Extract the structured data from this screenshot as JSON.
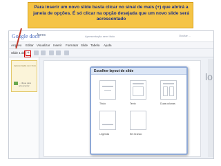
{
  "callout": {
    "text": "Para inserir um novo slide basta clicar no sinal de mais (+) que abrirá a janela de opções. É só clicar na opção desejada que um novo slide será acrescentado"
  },
  "app": {
    "logo": "Google docs",
    "tab": "Apres",
    "doc_title": "Apresentação sem título",
    "top_right": "Ocultar ..."
  },
  "menus": [
    "Arquivo",
    "Editar",
    "Visualizar",
    "Inserir",
    "Formatar",
    "Slide",
    "Tabela",
    "Ajuda"
  ],
  "toolbar": {
    "slide_label": "Slide 1 de 1",
    "plus": "+"
  },
  "thumbnail": {
    "text": "Apresentação sem título",
    "caption": "... clique para acrescentar"
  },
  "right_glimpse": "lo",
  "dialog": {
    "title": "Escolher layout de slide",
    "layouts": [
      {
        "label": "Título"
      },
      {
        "label": "Texto"
      },
      {
        "label": "Duas colunas"
      },
      {
        "label": "Legenda"
      },
      {
        "label": "Em branco"
      }
    ]
  },
  "colors": {
    "callout_bg": "#f5c445",
    "callout_text": "#1b2e8a",
    "highlight": "#cc0000"
  }
}
